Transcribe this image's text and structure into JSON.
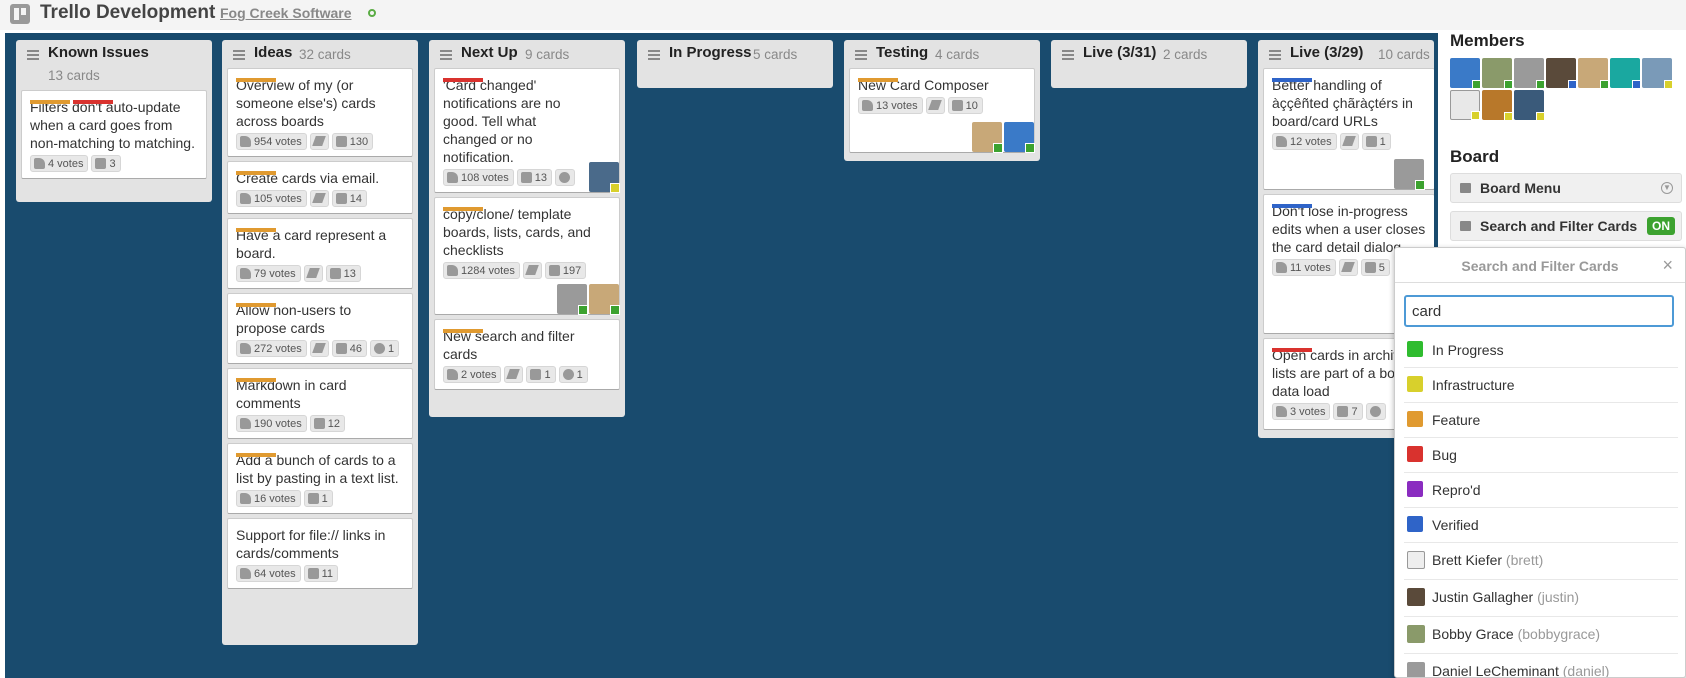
{
  "board": {
    "title": "Trello Development",
    "organization": "Fog Creek Software"
  },
  "lists": [
    {
      "title": "Known Issues",
      "count": "13 cards",
      "cards": [
        {
          "labels": [
            "#e09a30",
            "#d9322e"
          ],
          "title": "Filters don't auto-update when a card goes from non-matching to matching.",
          "votes": "4 votes",
          "comments": "3"
        }
      ]
    },
    {
      "title": "Ideas",
      "count": "32 cards",
      "cards": [
        {
          "labels": [
            "#e09a30"
          ],
          "title": "Overview of my (or someone else's) cards across boards",
          "votes": "954 votes",
          "comments": "130"
        },
        {
          "labels": [
            "#e09a30"
          ],
          "title": "Create cards via email.",
          "votes": "105 votes",
          "comments": "14"
        },
        {
          "labels": [
            "#e09a30"
          ],
          "title": "Have a card represent a board.",
          "votes": "79 votes",
          "comments": "13"
        },
        {
          "labels": [
            "#e09a30"
          ],
          "title": "Allow non-users to propose cards",
          "votes": "272 votes",
          "comments": "46",
          "checklist": "1"
        },
        {
          "labels": [
            "#e09a30"
          ],
          "title": "Markdown in card comments",
          "votes": "190 votes",
          "comments": "12"
        },
        {
          "labels": [
            "#e09a30"
          ],
          "title": "Add a bunch of cards to a list by pasting in a text list.",
          "votes": "16 votes",
          "comments": "1"
        },
        {
          "labels": [],
          "title": "Support for file:// links in cards/comments",
          "votes": "64 votes",
          "comments": "11"
        }
      ]
    },
    {
      "title": "Next Up",
      "count": "9 cards",
      "cards": [
        {
          "labels": [
            "#d9322e"
          ],
          "title": "'Card changed' notifications are no good. Tell what changed or no notification.",
          "votes": "108 votes",
          "comments": "13"
        },
        {
          "labels": [
            "#e09a30"
          ],
          "title": "copy/clone/ template boards, lists, cards, and checklists",
          "votes": "1284 votes",
          "comments": "197"
        },
        {
          "labels": [
            "#e09a30"
          ],
          "title": "New search and filter cards",
          "votes": "2 votes",
          "comments": "1",
          "checklist": "1"
        }
      ]
    },
    {
      "title": "In Progress",
      "count": "5 cards",
      "cards": []
    },
    {
      "title": "Testing",
      "count": "4 cards",
      "cards": [
        {
          "labels": [
            "#e09a30"
          ],
          "title": "New Card Composer",
          "votes": "13 votes",
          "comments": "10"
        }
      ]
    },
    {
      "title": "Live (3/31)",
      "count": "2 cards",
      "cards": []
    },
    {
      "title": "Live (3/29)",
      "count": "10 cards",
      "cards": [
        {
          "labels": [
            "#2f64c8"
          ],
          "title": "Better handling of àççêñted çhãràçtérs in board/card URLs",
          "votes": "12 votes",
          "comments": "1"
        },
        {
          "labels": [
            "#2f64c8"
          ],
          "title": "Don't lose in-progress edits when a user closes the card detail dialog",
          "votes": "11 votes",
          "comments": "5"
        },
        {
          "labels": [
            "#d9322e"
          ],
          "title": "Open cards in archived lists are part of a board's data load",
          "votes": "3 votes",
          "comments": "7"
        }
      ]
    }
  ],
  "sidebar": {
    "members_title": "Members",
    "board_title": "Board",
    "board_menu": "Board Menu",
    "search_filter": "Search and Filter Cards",
    "search_filter_state": "ON"
  },
  "popover": {
    "title": "Search and Filter Cards",
    "close": "×",
    "search_value": "card",
    "labels": [
      {
        "name": "In Progress",
        "color": "#2fbc2f"
      },
      {
        "name": "Infrastructure",
        "color": "#d8d02c"
      },
      {
        "name": "Feature",
        "color": "#e09a30"
      },
      {
        "name": "Bug",
        "color": "#d9322e"
      },
      {
        "name": "Repro'd",
        "color": "#8a2cc0"
      },
      {
        "name": "Verified",
        "color": "#2f64c8"
      }
    ],
    "members": [
      {
        "name": "Brett Kiefer",
        "username": "(brett)"
      },
      {
        "name": "Justin Gallagher",
        "username": "(justin)"
      },
      {
        "name": "Bobby Grace",
        "username": "(bobbygrace)"
      },
      {
        "name": "Daniel LeCheminant",
        "username": "(daniel)"
      }
    ]
  }
}
